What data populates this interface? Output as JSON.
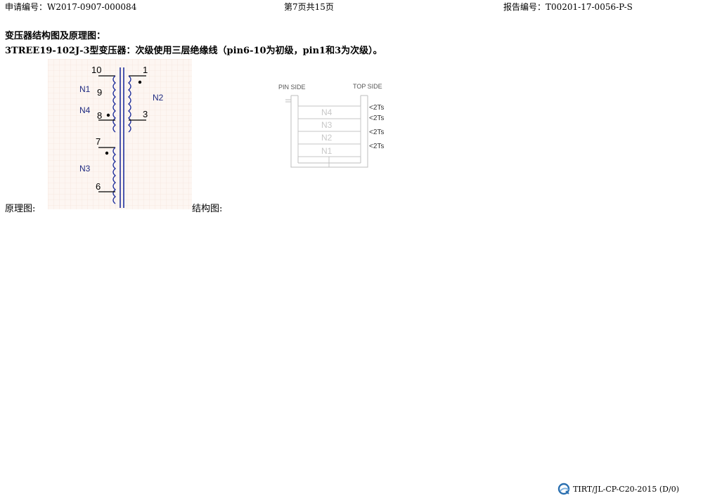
{
  "header": {
    "application_no": "申请编号：W2017-0907-000084",
    "page": "第7页共15页",
    "report_no": "报告编号：T00201-17-0056-P-S"
  },
  "heading": "变压器结构图及原理图：",
  "description": "3TREE19-102J-3型变压器：次级使用三层绝缘线（pin6-10为初级，pin1和3为次级）。",
  "schematic": {
    "caption": "原理图:",
    "pins": {
      "p10": "10",
      "p9": "9",
      "p8": "8",
      "p7": "7",
      "p6": "6",
      "p1": "1",
      "p3": "3"
    },
    "windings": {
      "n1": "N1",
      "n4": "N4",
      "n3": "N3",
      "n2": "N2"
    },
    "wire_color": "#1f2f9c",
    "label_color": "#1f2a80"
  },
  "structure": {
    "caption": "结构图:",
    "pin_side": "PIN SIDE",
    "top_side": "TOP SIDE",
    "layers": [
      "N4",
      "N3",
      "N2",
      "N1"
    ],
    "turns": [
      "<2Ts",
      "<2Ts",
      "<2Ts",
      "<2Ts"
    ]
  },
  "footer": {
    "code": "TIRT/JL-CP-C20-2015 (D/0)",
    "logo": "quality-logo-icon"
  }
}
